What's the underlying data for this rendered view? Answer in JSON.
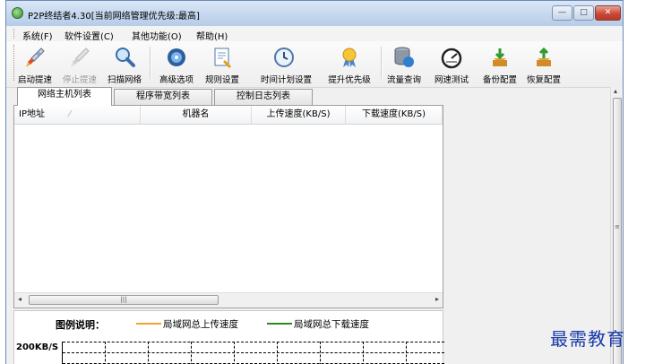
{
  "window": {
    "title": "P2P终结者4.30[当前网络管理优先级:最高]",
    "controls": {
      "minimize": "—",
      "maximize": "□",
      "close": "✕"
    }
  },
  "menu": [
    "系统(F)",
    "软件设置(C)",
    "其他功能(O)",
    "帮助(H)"
  ],
  "toolbar": [
    {
      "label": "启动提速",
      "icon": "rocket-icon",
      "enabled": true
    },
    {
      "label": "停止提速",
      "icon": "rocket-gray-icon",
      "enabled": false
    },
    {
      "label": "扫描网络",
      "icon": "magnifier-icon",
      "enabled": true
    },
    {
      "label": "高级选项",
      "icon": "disc-icon",
      "enabled": true
    },
    {
      "label": "规则设置",
      "icon": "document-icon",
      "enabled": true
    },
    {
      "label": "时间计划设置",
      "icon": "clock-icon",
      "enabled": true
    },
    {
      "label": "提升优先级",
      "icon": "medal-icon",
      "enabled": true
    },
    {
      "label": "流量查询",
      "icon": "database-icon",
      "enabled": true
    },
    {
      "label": "网速测试",
      "icon": "speedometer-icon",
      "enabled": true
    },
    {
      "label": "备份配置",
      "icon": "backup-icon",
      "enabled": true
    },
    {
      "label": "恢复配置",
      "icon": "restore-icon",
      "enabled": true
    }
  ],
  "tabs": [
    {
      "label": "网络主机列表",
      "active": true
    },
    {
      "label": "程序带宽列表",
      "active": false
    },
    {
      "label": "控制日志列表",
      "active": false
    }
  ],
  "host_list": {
    "columns": [
      "IP地址",
      "机器名",
      "上传速度(KB/S)",
      "下载速度(KB/S)"
    ],
    "rows": []
  },
  "legend": {
    "title": "图例说明：",
    "items": [
      {
        "label": "局域网总上传速度",
        "color": "#f5a033"
      },
      {
        "label": "局域网总下载速度",
        "color": "#2a8a1f"
      }
    ]
  },
  "graph": {
    "y_max_label": "200KB/S"
  },
  "watermark": "最需教育"
}
